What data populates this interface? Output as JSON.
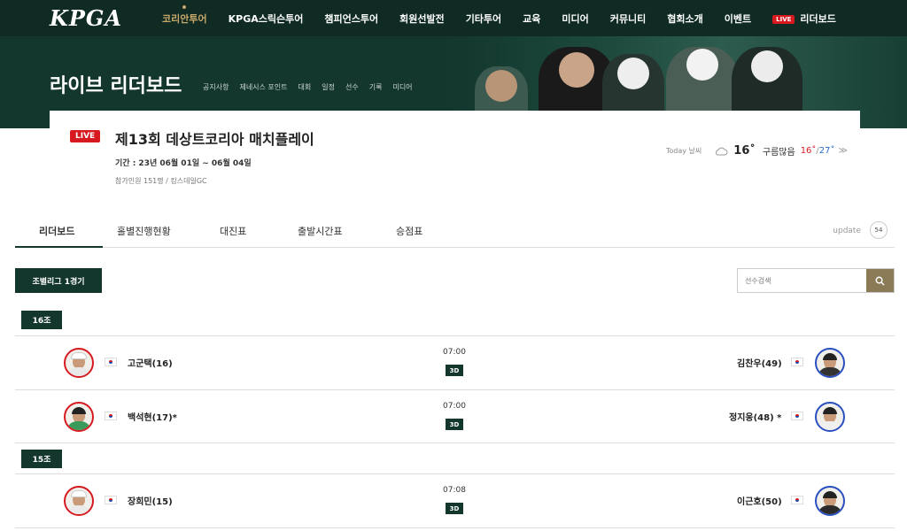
{
  "nav": {
    "logo": "KPGA",
    "items": [
      {
        "label": "코리안투어",
        "active": true
      },
      {
        "label": "KPGA스릭슨투어"
      },
      {
        "label": "챔피언스투어"
      },
      {
        "label": "회원선발전"
      },
      {
        "label": "기타투어"
      },
      {
        "label": "교육"
      },
      {
        "label": "미디어"
      },
      {
        "label": "커뮤니티"
      },
      {
        "label": "협회소개"
      },
      {
        "label": "이벤트"
      }
    ],
    "live_badge": "LIVE",
    "leaderboard": "리더보드"
  },
  "hero": {
    "title": "라이브 리더보드",
    "submenu": [
      "공지사항",
      "제네시스 포인트",
      "대회",
      "일정",
      "선수",
      "기록",
      "미디어"
    ]
  },
  "event": {
    "live": "LIVE",
    "title": "제13회 데상트코리아 매치플레이",
    "period": "기간 : 23년 06월 01일 ~ 06월 04일",
    "info": "참가인원 151명 / 킹스데일GC"
  },
  "weather": {
    "today_label": "Today 날씨",
    "icon": "cloud-icon",
    "temp": "16˚",
    "condition": "구름많음",
    "low": "16˚",
    "separator": "/",
    "high": "27˚",
    "more": "≫"
  },
  "tabs": [
    {
      "label": "리더보드",
      "active": true
    },
    {
      "label": "홀별진행현황"
    },
    {
      "label": "대진표"
    },
    {
      "label": "출발시간표"
    },
    {
      "label": "승점표"
    }
  ],
  "update": {
    "label": "update",
    "value": "54"
  },
  "league_button": "조별리그 1경기",
  "search": {
    "placeholder": "선수검색",
    "icon": "search-icon"
  },
  "groups": [
    {
      "label": "16조",
      "matches": [
        {
          "time": "07:00",
          "tag": "3D",
          "left": {
            "name": "고군택(16)"
          },
          "right": {
            "name": "김찬우(49)"
          }
        },
        {
          "time": "07:00",
          "tag": "3D",
          "left": {
            "name": "백석현(17)*"
          },
          "right": {
            "name": "정지웅(48) *"
          }
        }
      ]
    },
    {
      "label": "15조",
      "matches": [
        {
          "time": "07:08",
          "tag": "3D",
          "left": {
            "name": "장희민(15)"
          },
          "right": {
            "name": "이근호(50)"
          }
        }
      ]
    }
  ],
  "colors": {
    "primary": "#13362d",
    "accent": "#c8a96b",
    "live": "#d71920",
    "search_button": "#8a7a56"
  }
}
